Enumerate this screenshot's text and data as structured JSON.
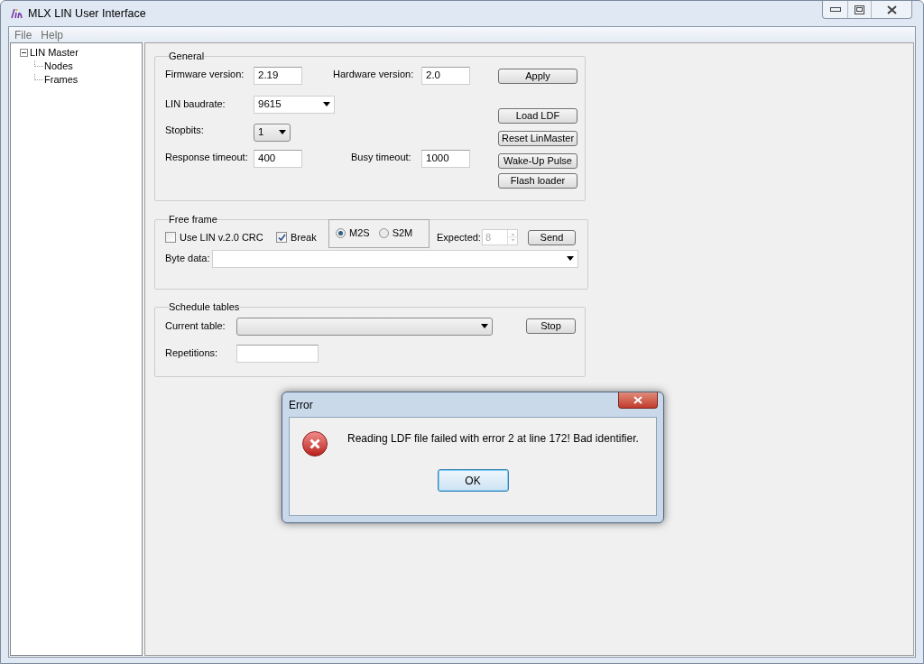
{
  "window": {
    "title": "MLX LIN User Interface"
  },
  "menu": [
    "File",
    "Help"
  ],
  "tree": [
    {
      "label": "LIN Master",
      "expanded": true,
      "children": [
        {
          "label": "Nodes"
        },
        {
          "label": "Frames"
        }
      ]
    }
  ],
  "general": {
    "title": "General",
    "firmware": {
      "label": "Firmware version:",
      "value": "2.19"
    },
    "hardware": {
      "label": "Hardware version:",
      "value": "2.0"
    },
    "baudrate": {
      "label": "LIN baudrate:",
      "value": "9615"
    },
    "stopbits": {
      "label": "Stopbits:",
      "value": "1"
    },
    "response_timeout": {
      "label": "Response timeout:",
      "value": "400"
    },
    "busy_timeout": {
      "label": "Busy timeout:",
      "value": "1000"
    },
    "buttons": [
      "Apply",
      "Load LDF",
      "Reset LinMaster",
      "Wake-Up Pulse",
      "Flash loader"
    ]
  },
  "free_frame": {
    "title": "Free frame",
    "checkboxes": [
      {
        "label": "Use LIN v.2.0 CRC",
        "checked": false
      },
      {
        "label": "Break",
        "checked": true
      }
    ],
    "direction": [
      {
        "label": "M2S",
        "selected": true
      },
      {
        "label": "S2M",
        "selected": false
      }
    ],
    "expected": {
      "label": "Expected:",
      "value": "8",
      "disabled": true
    },
    "send_button": "Send",
    "byte_data": {
      "label": "Byte data:"
    }
  },
  "schedule": {
    "title": "Schedule tables",
    "current_table": {
      "label": "Current table:"
    },
    "stop_button": "Stop",
    "repetitions": {
      "label": "Repetitions:"
    }
  },
  "dialog": {
    "title": "Error",
    "message": "Reading LDF file failed with error 2 at line 172! Bad identifier.",
    "ok_button": "OK"
  }
}
